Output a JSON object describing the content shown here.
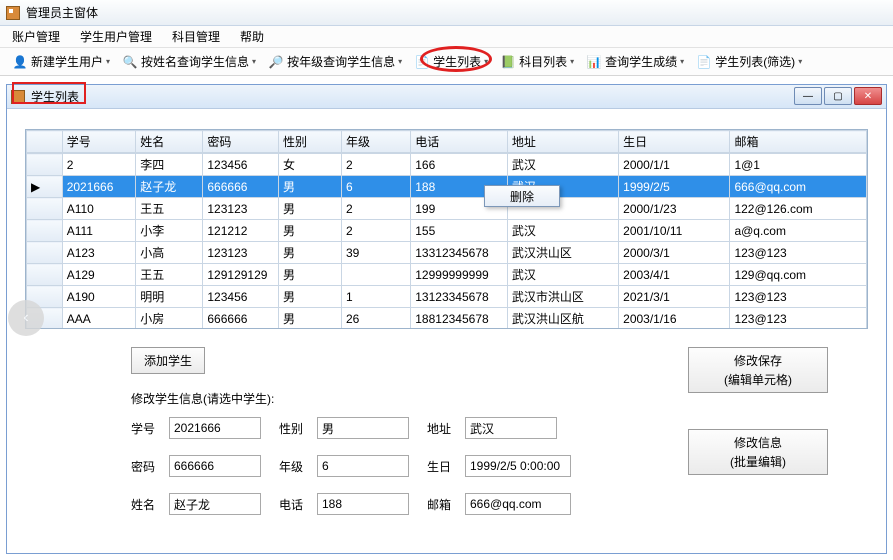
{
  "window": {
    "title": "管理员主窗体"
  },
  "menubar": [
    "账户管理",
    "学生用户管理",
    "科目管理",
    "帮助"
  ],
  "toolbar": [
    {
      "label": "新建学生用户",
      "icon": "👤",
      "dropdown": true
    },
    {
      "label": "按姓名查询学生信息",
      "icon": "🔍",
      "dropdown": true
    },
    {
      "label": "按年级查询学生信息",
      "icon": "🔎",
      "dropdown": true
    },
    {
      "label": "学生列表",
      "icon": "📄",
      "dropdown": true
    },
    {
      "label": "科目列表",
      "icon": "📗",
      "dropdown": true
    },
    {
      "label": "查询学生成绩",
      "icon": "📊",
      "dropdown": true
    },
    {
      "label": "学生列表(筛选)",
      "icon": "📄",
      "dropdown": true
    }
  ],
  "child": {
    "title": "学生列表"
  },
  "columns": [
    "学号",
    "姓名",
    "密码",
    "性别",
    "年级",
    "电话",
    "地址",
    "生日",
    "邮箱"
  ],
  "rows": [
    {
      "sel": false,
      "cells": [
        "2",
        "李四",
        "123456",
        "女",
        "2",
        "166",
        "武汉",
        "2000/1/1",
        "1@1"
      ]
    },
    {
      "sel": true,
      "cells": [
        "2021666",
        "赵子龙",
        "666666",
        "男",
        "6",
        "188",
        "武汉",
        "1999/2/5",
        "666@qq.com"
      ]
    },
    {
      "sel": false,
      "cells": [
        "A110",
        "王五",
        "123123",
        "男",
        "2",
        "199",
        "",
        "2000/1/23",
        "122@126.com"
      ]
    },
    {
      "sel": false,
      "cells": [
        "A111",
        "小李",
        "121212",
        "男",
        "2",
        "155",
        "武汉",
        "2001/10/11",
        "a@q.com"
      ]
    },
    {
      "sel": false,
      "cells": [
        "A123",
        "小高",
        "123123",
        "男",
        "39",
        "13312345678",
        "武汉洪山区",
        "2000/3/1",
        "123@123"
      ]
    },
    {
      "sel": false,
      "cells": [
        "A129",
        "王五",
        "129129129",
        "男",
        "",
        "12999999999",
        "武汉",
        "2003/4/1",
        "129@qq.com"
      ]
    },
    {
      "sel": false,
      "cells": [
        "A190",
        "明明",
        "123456",
        "男",
        "1",
        "13123345678",
        "武汉市洪山区",
        "2021/3/1",
        "123@123"
      ]
    },
    {
      "sel": false,
      "cells": [
        "AAA",
        "小房",
        "666666",
        "男",
        "26",
        "18812345678",
        "武汉洪山区航",
        "2003/1/16",
        "123@123"
      ]
    }
  ],
  "contextMenu": {
    "label": "删除"
  },
  "buttons": {
    "add": "添加学生",
    "saveEdit": "修改保存\n(编辑单元格)",
    "batchEdit": "修改信息\n(批量编辑)"
  },
  "formHint": "修改学生信息(请选中学生):",
  "form": {
    "id_label": "学号",
    "id": "2021666",
    "gender_label": "性别",
    "gender": "男",
    "addr_label": "地址",
    "addr": "武汉",
    "pwd_label": "密码",
    "pwd": "666666",
    "grade_label": "年级",
    "grade": "6",
    "bday_label": "生日",
    "bday": "1999/2/5 0:00:00",
    "name_label": "姓名",
    "name": "赵子龙",
    "phone_label": "电话",
    "phone": "188",
    "email_label": "邮箱",
    "email": "666@qq.com"
  }
}
